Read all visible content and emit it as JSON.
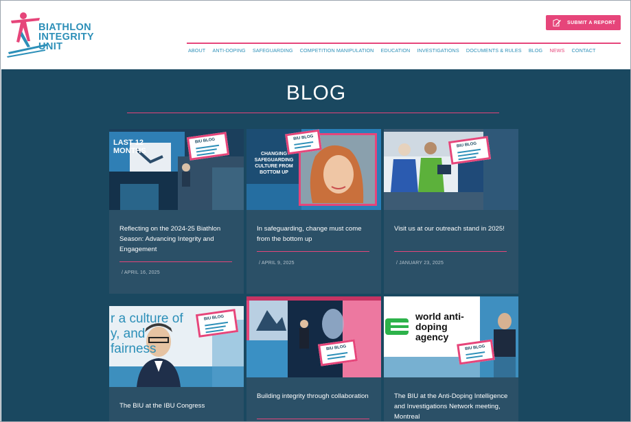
{
  "brand": {
    "lines": [
      "BIATHLON",
      "INTEGRITY",
      "UNIT"
    ]
  },
  "header": {
    "submit_label": "SUBMIT A REPORT"
  },
  "nav": [
    {
      "label": "ABOUT"
    },
    {
      "label": "ANTI-DOPING"
    },
    {
      "label": "SAFEGUARDING"
    },
    {
      "label": "COMPETITION MANIPULATION"
    },
    {
      "label": "EDUCATION"
    },
    {
      "label": "INVESTIGATIONS"
    },
    {
      "label": "DOCUMENTS & RULES"
    },
    {
      "label": "BLOG"
    },
    {
      "label": "NEWS"
    },
    {
      "label": "CONTACT"
    }
  ],
  "page": {
    "title": "BLOG"
  },
  "badge_text": "BIU BLOG",
  "colors": {
    "accent": "#e6457a",
    "brand_blue": "#2c8fb8",
    "background": "#1a4860",
    "card": "#2b5067"
  },
  "posts": [
    {
      "title": "Reflecting on the 2024-25 Biathlon Season: Advancing Integrity and Engagement",
      "date": "/ APRIL 16, 2025",
      "image_text": "LAST 12 MONTHS"
    },
    {
      "title": "In safeguarding, change must come from the bottom up",
      "date": "/ APRIL 9, 2025",
      "image_text": "CHANGING SAFEGUARDING CULTURE FROM BOTTOM UP"
    },
    {
      "title": "Visit us at our outreach stand in 2025!",
      "date": "/ JANUARY 23, 2025",
      "image_text": ""
    },
    {
      "title": "The BIU at the IBU Congress",
      "date": "",
      "image_text": "r a culture of y, and fairness"
    },
    {
      "title": "Building integrity through collaboration",
      "date": "",
      "image_text": ""
    },
    {
      "title": "The BIU at the Anti-Doping Intelligence and Investigations Network meeting, Montreal",
      "date": "",
      "image_text": "world anti-doping agency"
    }
  ]
}
